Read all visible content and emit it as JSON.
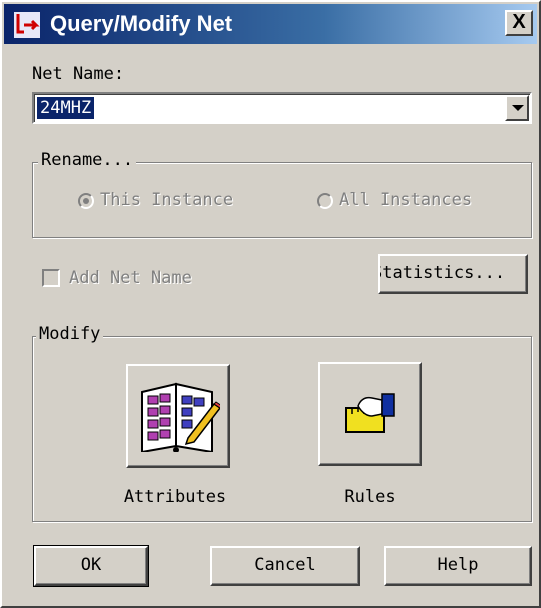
{
  "window": {
    "title": "Query/Modify Net",
    "close_label": "X",
    "app_icon": "app-logo-icon"
  },
  "net_name": {
    "label": "Net Name:",
    "value": "24MHZ"
  },
  "rename": {
    "group_label": "Rename...",
    "options": [
      {
        "label": "This Instance",
        "selected": true
      },
      {
        "label": "All Instances",
        "selected": false
      }
    ]
  },
  "add_net_name": {
    "label": "Add Net Name",
    "checked": false
  },
  "statistics_button": "Statistics...",
  "modify": {
    "group_label": "Modify",
    "attributes_label": "Attributes",
    "attributes_icon": "book-pencil-icon",
    "rules_label": "Rules",
    "rules_icon": "hand-ruler-icon"
  },
  "buttons": {
    "ok": "OK",
    "cancel": "Cancel",
    "help": "Help"
  },
  "colors": {
    "dialog_bg": "#d4d0c8",
    "title_bar": "#0a246a",
    "selection": "#0a246a"
  }
}
